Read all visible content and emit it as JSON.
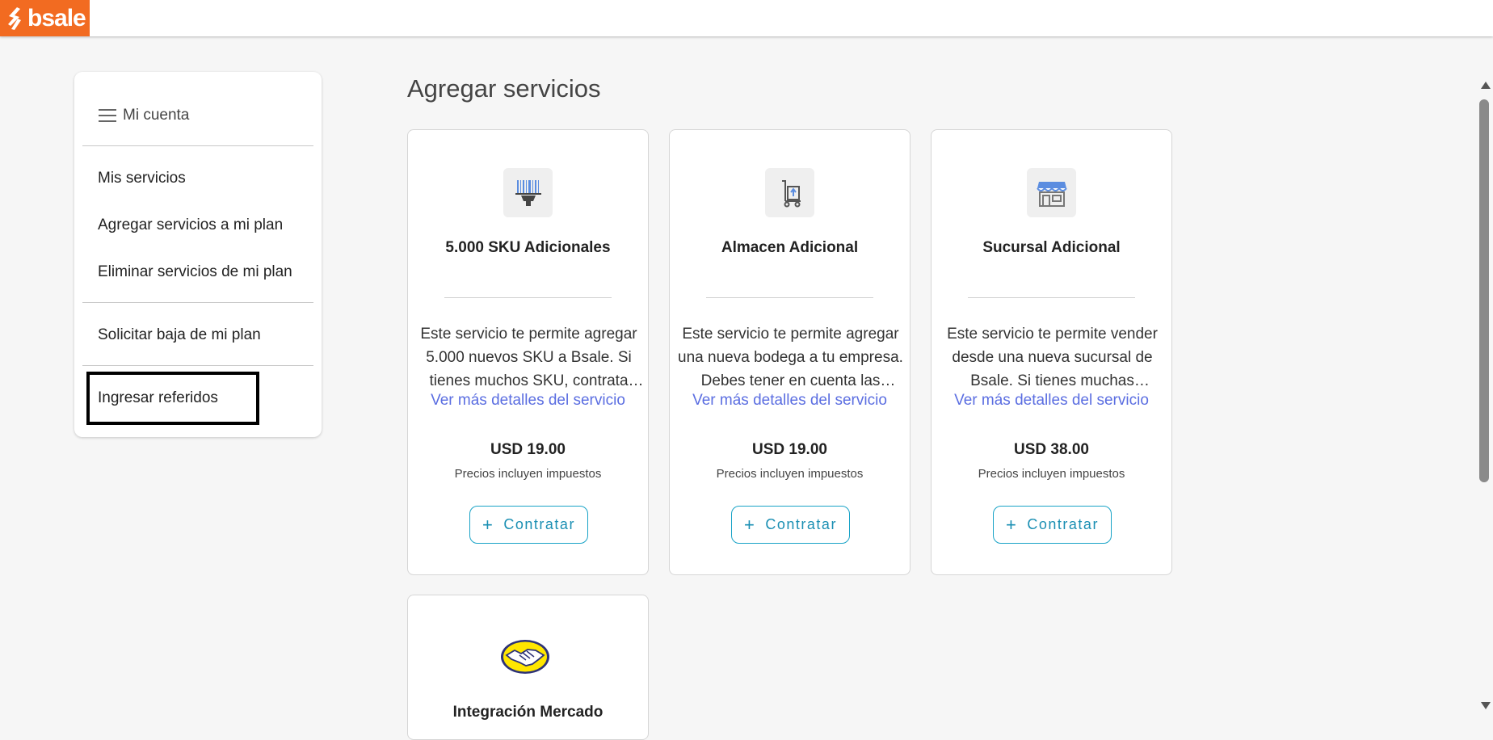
{
  "brand": {
    "name": "bsale",
    "color": "#f26b21"
  },
  "sidebar": {
    "header": "Mi cuenta",
    "items": [
      {
        "label": "Mis servicios"
      },
      {
        "label": "Agregar servicios a mi plan"
      },
      {
        "label": "Eliminar servicios de mi plan"
      },
      {
        "label": "Solicitar baja de mi plan"
      },
      {
        "label": "Ingresar referidos"
      }
    ]
  },
  "main": {
    "title": "Agregar servicios",
    "cards": [
      {
        "icon": "barcode-scanner-icon",
        "title": "5.000 SKU Adicionales",
        "description": "Este servicio te permite agregar 5.000 nuevos SKU a Bsale. Si tienes muchos SKU, contrata este servicio.",
        "link": "Ver más detalles del servicio",
        "price": "USD 19.00",
        "tax_note": "Precios incluyen impuestos",
        "button": "Contratar"
      },
      {
        "icon": "warehouse-cart-icon",
        "title": "Almacen Adicional",
        "description": "Este servicio te permite agregar una nueva bodega a tu empresa. Debes tener en cuenta las condiciones.",
        "link": "Ver más detalles del servicio",
        "price": "USD 19.00",
        "tax_note": "Precios incluyen impuestos",
        "button": "Contratar"
      },
      {
        "icon": "store-icon",
        "title": "Sucursal Adicional",
        "description": "Este servicio te permite vender desde una nueva sucursal de Bsale. Si tienes muchas sucursales, contrata este servicio.",
        "link": "Ver más detalles del servicio",
        "price": "USD 38.00",
        "tax_note": "Precios incluyen impuestos",
        "button": "Contratar"
      },
      {
        "icon": "handshake-icon",
        "title": "Integración Mercado"
      }
    ]
  }
}
